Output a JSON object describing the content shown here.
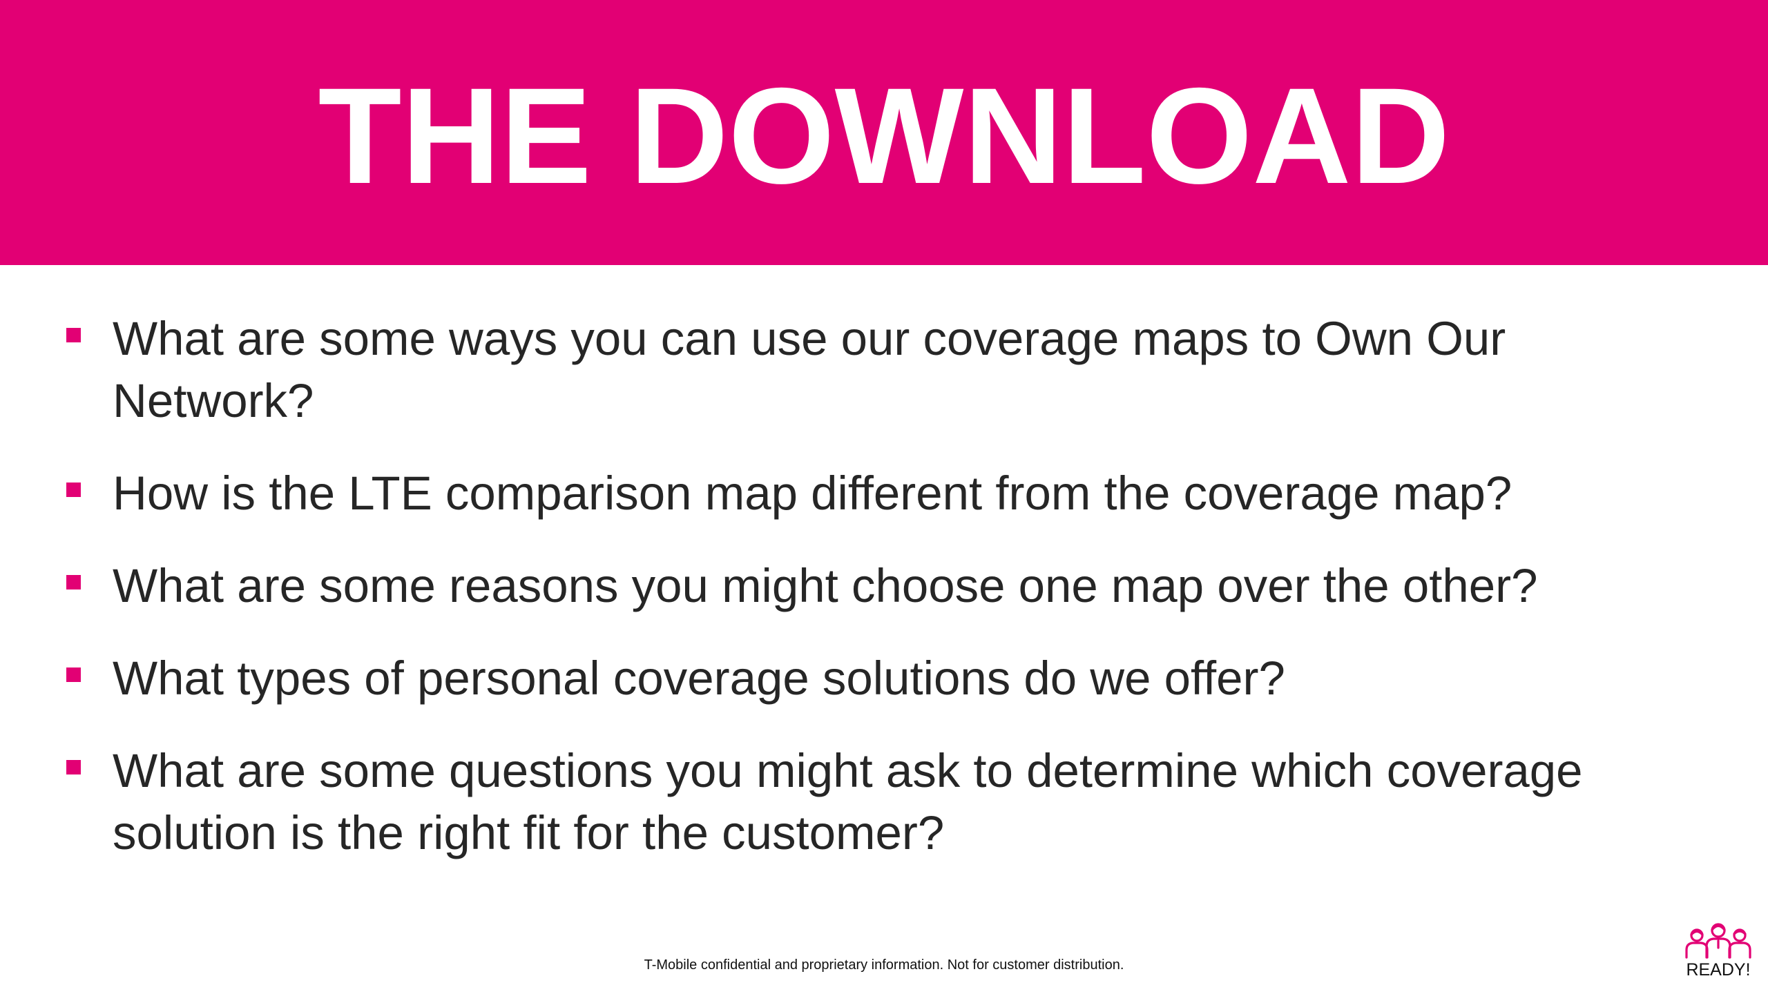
{
  "header": {
    "title": "THE DOWNLOAD"
  },
  "bullets": [
    "What are some ways you can use our coverage maps to Own Our Network?",
    "How is the LTE comparison map different from the coverage map?",
    "What are some reasons you might choose one map over the other?",
    "What types of personal coverage solutions do we offer?",
    "What are some questions you might ask to determine which coverage solution is the right fit for the customer?"
  ],
  "footer": {
    "note": "T-Mobile confidential and proprietary information. Not for customer distribution."
  },
  "logo": {
    "label": "READY!",
    "icon": "people-group-icon"
  },
  "colors": {
    "brand_magenta": "#E20074",
    "text_dark": "#262626",
    "background": "#FFFFFF"
  }
}
